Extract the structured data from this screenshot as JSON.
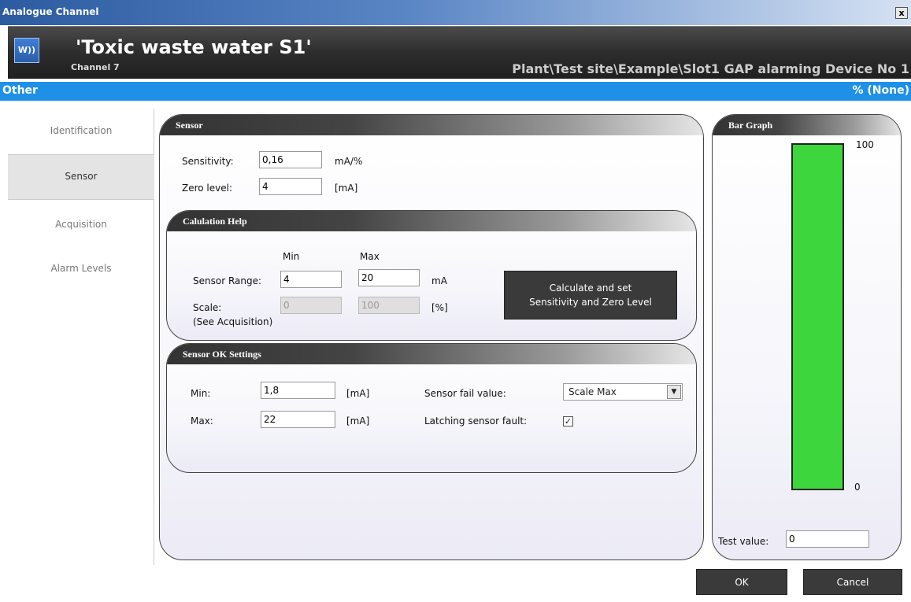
{
  "window": {
    "title": "Analogue Channel",
    "close_label": "x"
  },
  "header": {
    "logo_text": "W))",
    "channel_name": "'Toxic waste water S1'",
    "channel_number": "Channel 7",
    "path": "Plant\\Test site\\Example\\Slot1 GAP alarming Device No 1"
  },
  "status_bar": {
    "left": "Other",
    "right": "% (None)"
  },
  "nav": {
    "items": [
      {
        "label": "Identification",
        "active": false
      },
      {
        "label": "Sensor",
        "active": true
      },
      {
        "label": "Acquisition",
        "active": false
      },
      {
        "label": "Alarm Levels",
        "active": false
      }
    ]
  },
  "sensor": {
    "title": "Sensor",
    "sensitivity_label": "Sensitivity:",
    "sensitivity_value": "0,16",
    "sensitivity_unit": "mA/%",
    "zero_label": "Zero level:",
    "zero_value": "4",
    "zero_unit": "[mA]"
  },
  "calc": {
    "title": "Calulation Help",
    "min_header": "Min",
    "max_header": "Max",
    "range_label": "Sensor Range:",
    "range_min": "4",
    "range_max": "20",
    "range_unit": "mA",
    "scale_label": "Scale:",
    "scale_min": "0",
    "scale_max": "100",
    "scale_unit": "[%]",
    "scale_note": "(See Acquisition)",
    "button_line1": "Calculate and set",
    "button_line2": "Sensitivity and Zero Level"
  },
  "ok_settings": {
    "title": "Sensor OK Settings",
    "min_label": "Min:",
    "min_value": "1,8",
    "min_unit": "[mA]",
    "max_label": "Max:",
    "max_value": "22",
    "max_unit": "[mA]",
    "fail_label": "Sensor fail value:",
    "fail_value": "Scale Max",
    "latching_label": "Latching sensor fault:",
    "latching_checked": true,
    "check_mark": "✓"
  },
  "bar_graph": {
    "title": "Bar Graph",
    "max_label": "100",
    "min_label": "0",
    "fill_fraction": 1.0,
    "bar_color": "#3dd63d",
    "test_label": "Test value:",
    "test_value": "0"
  },
  "footer": {
    "ok_label": "OK",
    "cancel_label": "Cancel"
  },
  "colors": {
    "accent_blue": "#1e90e8",
    "header_dark": "#2d2d2d",
    "button_dark": "#3a3a3a"
  }
}
